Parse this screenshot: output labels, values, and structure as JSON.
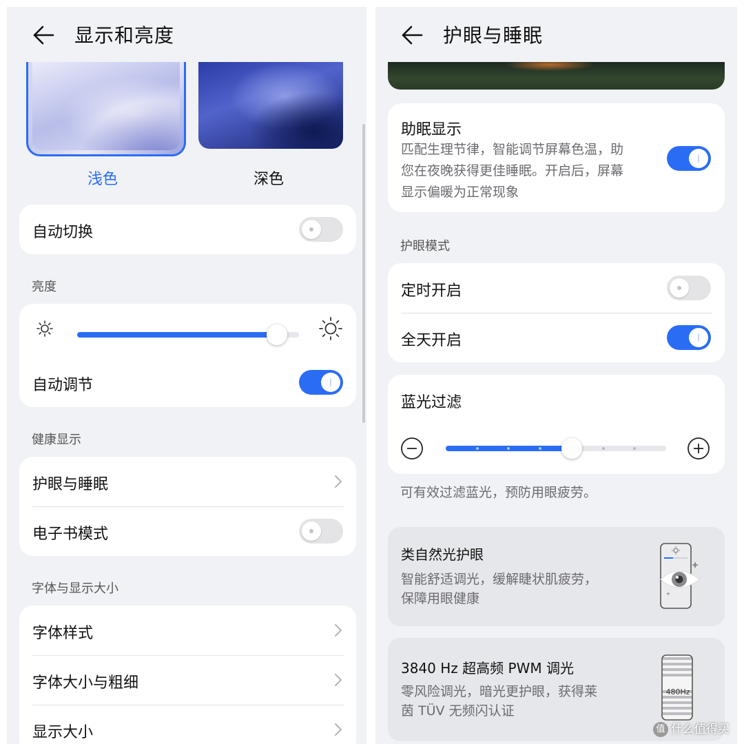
{
  "colors": {
    "accent": "#2a6df4",
    "background": "#f1f2f5",
    "card": "#ffffff",
    "toggle_off": "#e4e4e7"
  },
  "left": {
    "title": "显示和亮度",
    "themes": [
      {
        "label": "浅色",
        "selected": true
      },
      {
        "label": "深色",
        "selected": false
      }
    ],
    "auto_switch": {
      "label": "自动切换",
      "on": false
    },
    "brightness": {
      "section": "亮度",
      "level_fraction": 0.9,
      "auto_adjust": {
        "label": "自动调节",
        "on": true
      },
      "min_icon": "sun-small-icon",
      "max_icon": "sun-large-icon"
    },
    "health": {
      "section": "健康显示",
      "eye_sleep": {
        "label": "护眼与睡眠",
        "icon": "chevron-right-icon"
      },
      "ebook": {
        "label": "电子书模式",
        "on": false
      }
    },
    "font": {
      "section": "字体与显示大小",
      "items": [
        {
          "label": "字体样式"
        },
        {
          "label": "字体大小与粗细"
        },
        {
          "label": "显示大小"
        }
      ]
    }
  },
  "right": {
    "title": "护眼与睡眠",
    "sleep_display": {
      "title": "助眠显示",
      "desc_lines": [
        "匹配生理节律，智能调节屏幕色温，助",
        "您在夜晚获得更佳睡眠。开启后，屏幕",
        "显示偏暖为正常现象"
      ],
      "on": true
    },
    "eye_mode": {
      "section": "护眼模式",
      "scheduled": {
        "label": "定时开启",
        "on": false
      },
      "all_day": {
        "label": "全天开启",
        "on": true
      }
    },
    "blue_filter": {
      "title": "蓝光过滤",
      "level_step": 4,
      "steps": 8,
      "decrease_icon": "minus-circle-icon",
      "increase_icon": "plus-circle-icon",
      "hint": "可有效过滤蓝光，预防用眼疲劳。"
    },
    "features": [
      {
        "title": "类自然光护眼",
        "desc_lines": [
          "智能舒适调光，缓解睫状肌疲劳，",
          "保障用眼健康"
        ],
        "icon": "eye-phone-icon"
      },
      {
        "title": "3840 Hz 超高频 PWM 调光",
        "desc_lines": [
          "零风险调光，暗光更护眼，获得莱",
          "茵 TÜV 无频闪认证"
        ],
        "icon": "pwm-phone-icon",
        "icon_text": "480Hz"
      }
    ]
  },
  "watermark": {
    "badge": "值",
    "text": "什么值得买"
  }
}
